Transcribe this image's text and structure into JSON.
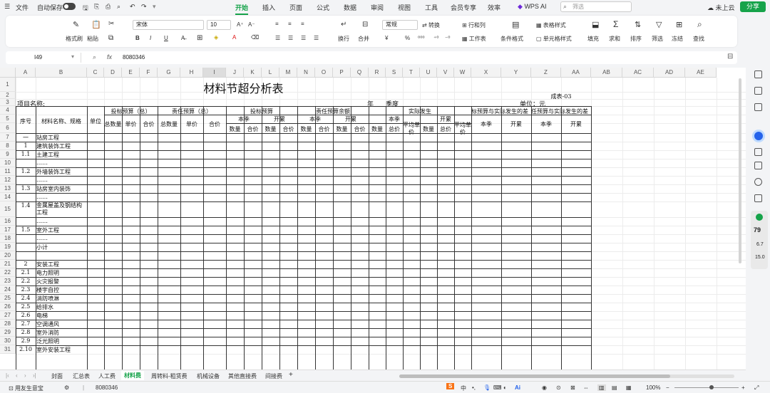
{
  "topbar": {
    "file": "文件",
    "autosave": "自动保存",
    "tabs": [
      "开始",
      "插入",
      "页面",
      "公式",
      "数据",
      "审阅",
      "视图",
      "工具",
      "会员专享",
      "效率",
      "WPS AI"
    ],
    "search_placeholder": "筛选",
    "cloud": "未上云",
    "share": "分享"
  },
  "ribbon": {
    "format_painter": "格式刷",
    "paste": "粘贴",
    "font_name": "宋体",
    "font_size": "10",
    "number_format": "常规",
    "convert": "转换",
    "rows_cols": "行和列",
    "table_style": "表格样式",
    "worksheet": "工作表",
    "cond_format": "条件格式",
    "cell_style": "单元格样式",
    "wrap": "换行",
    "merge": "合并",
    "fill": "填充",
    "sum": "求和",
    "sort": "排序",
    "filter": "筛选",
    "freeze": "冻结",
    "find": "查找"
  },
  "formula_bar": {
    "name_box": "I49",
    "fx": "fx",
    "value": "8080346"
  },
  "columns": [
    "A",
    "B",
    "C",
    "D",
    "E",
    "F",
    "G",
    "H",
    "I",
    "J",
    "K",
    "L",
    "M",
    "N",
    "O",
    "P",
    "Q",
    "R",
    "S",
    "T",
    "U",
    "V",
    "W",
    "X",
    "Y",
    "Z",
    "AA",
    "AB",
    "AC",
    "AD",
    "AE"
  ],
  "rows": [
    "1",
    "2",
    "3",
    "4",
    "5",
    "6",
    "7",
    "8",
    "9",
    "10",
    "11",
    "12",
    "13",
    "14",
    "15",
    "16",
    "17",
    "18",
    "19",
    "20",
    "21",
    "22",
    "23",
    "24",
    "25",
    "26",
    "27",
    "28",
    "29",
    "30",
    "31"
  ],
  "sheet": {
    "title": "材料节超分析表",
    "form_no": "成表-03",
    "project_name": "项目名称:",
    "year": "年",
    "quarter": "季度",
    "unit_label": "单位：元",
    "headers": {
      "seq": "序号",
      "name_spec": "材料名称、规格",
      "unit": "单位",
      "bid_budget_total": "投标预算（总）",
      "resp_budget_total": "责任预算（总）",
      "bid_budget": "投标预算",
      "resp_budget_balance": "责任预算余额",
      "actual": "实际发生",
      "bid_vs_actual": "标预算与实际发生的差",
      "resp_vs_actual": "任预算与实际发生的差",
      "this_q": "本季",
      "cum": "开累",
      "total_qty": "总数量",
      "unit_price": "单价",
      "amount": "合价",
      "qty": "数量",
      "total": "总价",
      "avg_price": "平均单价"
    },
    "items": [
      {
        "no": "一",
        "name": "站房工程"
      },
      {
        "no": "1",
        "name": "建筑装饰工程"
      },
      {
        "no": "1.1",
        "name": "土建工程"
      },
      {
        "no": "",
        "name": "……"
      },
      {
        "no": "1.2",
        "name": "外墙装饰工程"
      },
      {
        "no": "",
        "name": "……"
      },
      {
        "no": "1.3",
        "name": "站房室内装饰"
      },
      {
        "no": "",
        "name": "……"
      },
      {
        "no": "1.4",
        "name": "金属屋盖及钢结构工程"
      },
      {
        "no": "",
        "name": "……"
      },
      {
        "no": "1.5",
        "name": "室外工程"
      },
      {
        "no": "",
        "name": "……"
      },
      {
        "no": "",
        "name": "小计"
      },
      {
        "no": "",
        "name": ""
      },
      {
        "no": "2",
        "name": "安装工程"
      },
      {
        "no": "2.1",
        "name": "电力照明"
      },
      {
        "no": "2.2",
        "name": "火灾报警"
      },
      {
        "no": "2.3",
        "name": "楼宇自控"
      },
      {
        "no": "2.4",
        "name": "消防喷淋"
      },
      {
        "no": "2.5",
        "name": "给排水"
      },
      {
        "no": "2.6",
        "name": "电梯"
      },
      {
        "no": "2.7",
        "name": "空调通风"
      },
      {
        "no": "2.8",
        "name": "室外消防"
      },
      {
        "no": "2.9",
        "name": "泛光照明"
      },
      {
        "no": "2.10",
        "name": "室外安装工程"
      }
    ]
  },
  "sheet_tabs": [
    "封面",
    "汇总表",
    "人工费",
    "材料费",
    "周转料-租赁费",
    "机械设备",
    "其他直接费",
    "间接费"
  ],
  "active_sheet": "材料费",
  "status": {
    "user": "用友生意宝",
    "sum": "8080346",
    "zoom": "100%"
  },
  "widget": {
    "score": "79",
    "v1": "6.7",
    "v2": "15.0"
  },
  "colors": {
    "accent": "#16a34a"
  }
}
